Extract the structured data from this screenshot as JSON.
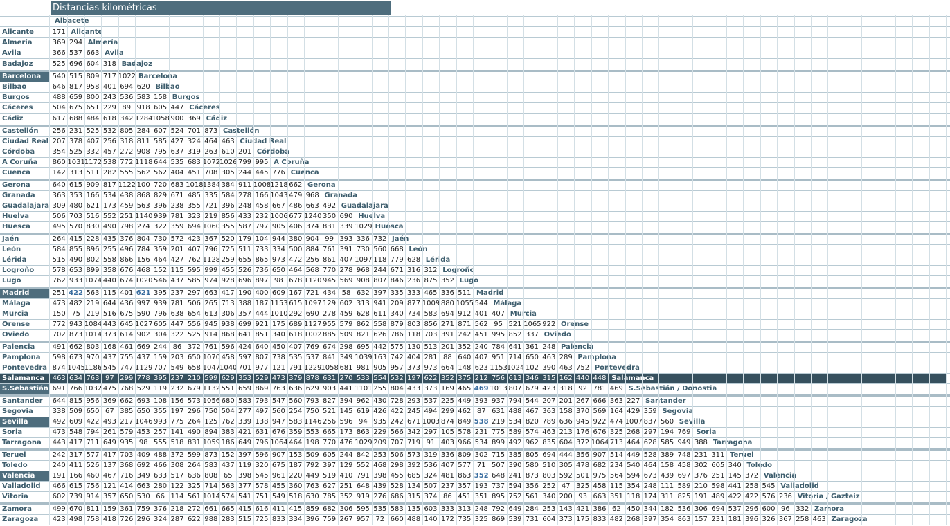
{
  "title": "Distancias kilométricas",
  "first_city": "Albacete",
  "rows": [
    {
      "name": "Alicante",
      "values": [
        "171"
      ]
    },
    {
      "name": "Almería",
      "values": [
        "369",
        "294"
      ]
    },
    {
      "name": "Avila",
      "values": [
        "366",
        "537",
        "663"
      ]
    },
    {
      "name": "Badajoz",
      "values": [
        "525",
        "696",
        "604",
        "318"
      ]
    },
    {
      "name": "Barcelona",
      "values": [
        "540",
        "515",
        "809",
        "717",
        "1022"
      ],
      "hl": true
    },
    {
      "name": "Bilbao",
      "values": [
        "646",
        "817",
        "958",
        "401",
        "694",
        "620"
      ]
    },
    {
      "name": "Burgos",
      "values": [
        "488",
        "659",
        "800",
        "243",
        "536",
        "583",
        "158"
      ]
    },
    {
      "name": "Cáceres",
      "values": [
        "504",
        "675",
        "651",
        "229",
        "89",
        "918",
        "605",
        "447"
      ]
    },
    {
      "name": "Cádiz",
      "values": [
        "617",
        "688",
        "484",
        "618",
        "342",
        "1284",
        "1058",
        "900",
        "369"
      ]
    },
    {
      "name": "Castellón",
      "values": [
        "256",
        "231",
        "525",
        "532",
        "805",
        "284",
        "607",
        "524",
        "701",
        "873"
      ]
    },
    {
      "name": "Ciudad Real",
      "values": [
        "207",
        "378",
        "407",
        "256",
        "318",
        "811",
        "585",
        "427",
        "324",
        "464",
        "463"
      ]
    },
    {
      "name": "Córdoba",
      "values": [
        "354",
        "525",
        "332",
        "457",
        "272",
        "908",
        "795",
        "637",
        "319",
        "263",
        "610",
        "201"
      ]
    },
    {
      "name": "A Coruña",
      "values": [
        "860",
        "1031",
        "1172",
        "538",
        "772",
        "1118",
        "644",
        "535",
        "683",
        "1072",
        "1026",
        "799",
        "995"
      ]
    },
    {
      "name": "Cuenca",
      "values": [
        "142",
        "313",
        "511",
        "282",
        "555",
        "562",
        "562",
        "404",
        "451",
        "708",
        "305",
        "244",
        "445",
        "776"
      ]
    },
    {
      "name": "Gerona",
      "values": [
        "640",
        "615",
        "909",
        "817",
        "1122",
        "100",
        "720",
        "683",
        "1018",
        "1384",
        "384",
        "911",
        "1008",
        "1218",
        "662"
      ]
    },
    {
      "name": "Granada",
      "values": [
        "363",
        "353",
        "166",
        "534",
        "438",
        "868",
        "829",
        "671",
        "485",
        "335",
        "584",
        "278",
        "166",
        "1043",
        "479",
        "968"
      ]
    },
    {
      "name": "Guadalajara",
      "values": [
        "309",
        "480",
        "621",
        "173",
        "459",
        "563",
        "396",
        "238",
        "355",
        "721",
        "396",
        "248",
        "458",
        "667",
        "486",
        "663",
        "492"
      ]
    },
    {
      "name": "Huelva",
      "values": [
        "506",
        "703",
        "516",
        "552",
        "251",
        "1140",
        "939",
        "781",
        "323",
        "219",
        "856",
        "433",
        "232",
        "1006",
        "677",
        "1240",
        "350",
        "690"
      ]
    },
    {
      "name": "Huesca",
      "values": [
        "495",
        "570",
        "830",
        "490",
        "798",
        "274",
        "322",
        "359",
        "694",
        "1060",
        "355",
        "587",
        "797",
        "905",
        "406",
        "374",
        "831",
        "339",
        "1029"
      ]
    },
    {
      "name": "Jaén",
      "values": [
        "264",
        "415",
        "228",
        "435",
        "376",
        "804",
        "730",
        "572",
        "423",
        "367",
        "520",
        "179",
        "104",
        "944",
        "380",
        "904",
        "99",
        "393",
        "336",
        "732"
      ]
    },
    {
      "name": "León",
      "values": [
        "584",
        "855",
        "896",
        "255",
        "496",
        "784",
        "359",
        "201",
        "407",
        "796",
        "725",
        "511",
        "733",
        "334",
        "500",
        "884",
        "761",
        "391",
        "730",
        "560",
        "668"
      ]
    },
    {
      "name": "Lérida",
      "values": [
        "515",
        "490",
        "802",
        "558",
        "866",
        "156",
        "464",
        "427",
        "762",
        "1128",
        "259",
        "655",
        "865",
        "973",
        "472",
        "256",
        "861",
        "407",
        "1097",
        "118",
        "779",
        "628"
      ]
    },
    {
      "name": "Logroño",
      "values": [
        "578",
        "653",
        "899",
        "358",
        "676",
        "468",
        "152",
        "115",
        "595",
        "999",
        "455",
        "526",
        "736",
        "650",
        "464",
        "568",
        "770",
        "278",
        "968",
        "244",
        "671",
        "316",
        "312"
      ]
    },
    {
      "name": "Lugo",
      "values": [
        "762",
        "933",
        "1074",
        "440",
        "674",
        "1020",
        "546",
        "437",
        "585",
        "974",
        "928",
        "696",
        "897",
        "98",
        "678",
        "1120",
        "945",
        "569",
        "908",
        "807",
        "846",
        "236",
        "875",
        "352"
      ]
    },
    {
      "name": "Madrid",
      "values": [
        "251",
        "422",
        "563",
        "115",
        "401",
        "621",
        "395",
        "237",
        "297",
        "663",
        "417",
        "190",
        "400",
        "609",
        "167",
        "721",
        "434",
        "58",
        "632",
        "397",
        "335",
        "333",
        "465",
        "336",
        "511"
      ],
      "hl": true,
      "blue": [
        1,
        5
      ]
    },
    {
      "name": "Málaga",
      "values": [
        "473",
        "482",
        "219",
        "644",
        "436",
        "997",
        "939",
        "781",
        "506",
        "265",
        "713",
        "388",
        "187",
        "1153",
        "615",
        "1097",
        "129",
        "602",
        "313",
        "941",
        "209",
        "877",
        "1009",
        "880",
        "1055",
        "544"
      ]
    },
    {
      "name": "Murcia",
      "values": [
        "150",
        "75",
        "219",
        "516",
        "675",
        "590",
        "796",
        "638",
        "654",
        "613",
        "306",
        "357",
        "444",
        "1010",
        "292",
        "690",
        "278",
        "459",
        "628",
        "611",
        "340",
        "734",
        "583",
        "694",
        "912",
        "401",
        "407"
      ]
    },
    {
      "name": "Orense",
      "values": [
        "772",
        "943",
        "1084",
        "443",
        "645",
        "1027",
        "605",
        "447",
        "556",
        "945",
        "938",
        "699",
        "921",
        "175",
        "689",
        "1127",
        "955",
        "579",
        "862",
        "558",
        "879",
        "803",
        "856",
        "271",
        "871",
        "562",
        "95",
        "521",
        "1065",
        "922"
      ]
    },
    {
      "name": "Oviedo",
      "values": [
        "702",
        "873",
        "1014",
        "373",
        "614",
        "902",
        "304",
        "322",
        "525",
        "914",
        "868",
        "641",
        "851",
        "340",
        "618",
        "1002",
        "885",
        "509",
        "821",
        "626",
        "786",
        "118",
        "703",
        "391",
        "242",
        "451",
        "995",
        "852",
        "337"
      ]
    },
    {
      "name": "Palencia",
      "values": [
        "491",
        "662",
        "803",
        "168",
        "461",
        "669",
        "244",
        "86",
        "372",
        "761",
        "596",
        "424",
        "640",
        "450",
        "407",
        "769",
        "674",
        "298",
        "695",
        "442",
        "575",
        "130",
        "513",
        "201",
        "352",
        "240",
        "784",
        "641",
        "361",
        "248"
      ]
    },
    {
      "name": "Pamplona",
      "values": [
        "598",
        "673",
        "970",
        "437",
        "755",
        "437",
        "159",
        "203",
        "650",
        "1070",
        "458",
        "597",
        "807",
        "738",
        "535",
        "537",
        "841",
        "349",
        "1039",
        "163",
        "742",
        "404",
        "281",
        "88",
        "640",
        "407",
        "951",
        "714",
        "650",
        "463",
        "289"
      ]
    },
    {
      "name": "Pontevedra",
      "values": [
        "874",
        "1045",
        "1186",
        "545",
        "747",
        "1129",
        "707",
        "549",
        "658",
        "1047",
        "1040",
        "701",
        "977",
        "121",
        "791",
        "1229",
        "1058",
        "681",
        "981",
        "905",
        "957",
        "373",
        "973",
        "664",
        "148",
        "623",
        "1153",
        "1024",
        "102",
        "390",
        "463",
        "752"
      ]
    },
    {
      "name": "Salamanca",
      "values": [
        "463",
        "634",
        "763",
        "97",
        "299",
        "778",
        "395",
        "237",
        "210",
        "599",
        "629",
        "353",
        "529",
        "473",
        "379",
        "878",
        "631",
        "270",
        "533",
        "554",
        "532",
        "197",
        "622",
        "352",
        "375",
        "212",
        "756",
        "613",
        "346",
        "315",
        "162",
        "440",
        "448"
      ],
      "dark": true
    },
    {
      "name": "S.Sebastián",
      "values": [
        "691",
        "766",
        "1032",
        "475",
        "768",
        "529",
        "119",
        "232",
        "679",
        "1132",
        "551",
        "659",
        "869",
        "763",
        "636",
        "629",
        "903",
        "441",
        "1101",
        "255",
        "804",
        "433",
        "373",
        "169",
        "465",
        "469",
        "1013",
        "807",
        "679",
        "423",
        "318",
        "92",
        "781",
        "469"
      ],
      "hl": true,
      "blue": [
        25
      ],
      "label": "S.Sebastián / Donostia"
    },
    {
      "name": "Santander",
      "values": [
        "644",
        "815",
        "956",
        "369",
        "662",
        "693",
        "108",
        "156",
        "573",
        "1056",
        "680",
        "583",
        "793",
        "547",
        "560",
        "793",
        "827",
        "394",
        "962",
        "430",
        "728",
        "293",
        "537",
        "225",
        "449",
        "393",
        "937",
        "794",
        "544",
        "207",
        "201",
        "267",
        "666",
        "363",
        "227"
      ]
    },
    {
      "name": "Segovia",
      "values": [
        "338",
        "509",
        "650",
        "67",
        "385",
        "650",
        "355",
        "197",
        "296",
        "750",
        "504",
        "277",
        "497",
        "560",
        "254",
        "750",
        "521",
        "145",
        "619",
        "426",
        "422",
        "245",
        "494",
        "299",
        "462",
        "87",
        "631",
        "488",
        "467",
        "363",
        "158",
        "370",
        "569",
        "164",
        "429",
        "359"
      ]
    },
    {
      "name": "Sevilla",
      "values": [
        "492",
        "609",
        "422",
        "493",
        "217",
        "1046",
        "993",
        "775",
        "264",
        "125",
        "762",
        "339",
        "138",
        "947",
        "583",
        "1146",
        "256",
        "596",
        "94",
        "935",
        "242",
        "671",
        "1003",
        "874",
        "849",
        "538",
        "219",
        "534",
        "820",
        "789",
        "636",
        "945",
        "922",
        "474",
        "1007",
        "837",
        "560"
      ],
      "hl": true,
      "blue": [
        25
      ]
    },
    {
      "name": "Soria",
      "values": [
        "473",
        "548",
        "794",
        "261",
        "579",
        "453",
        "257",
        "141",
        "490",
        "894",
        "383",
        "421",
        "631",
        "676",
        "359",
        "553",
        "665",
        "173",
        "863",
        "229",
        "566",
        "342",
        "297",
        "105",
        "578",
        "231",
        "775",
        "589",
        "574",
        "463",
        "213",
        "176",
        "676",
        "325",
        "268",
        "297",
        "194",
        "769"
      ]
    },
    {
      "name": "Tarragona",
      "values": [
        "443",
        "417",
        "711",
        "649",
        "935",
        "98",
        "555",
        "518",
        "831",
        "1059",
        "186",
        "649",
        "796",
        "1064",
        "464",
        "198",
        "770",
        "476",
        "1029",
        "209",
        "707",
        "719",
        "91",
        "403",
        "966",
        "534",
        "899",
        "492",
        "962",
        "835",
        "604",
        "372",
        "1064",
        "713",
        "464",
        "628",
        "585",
        "949",
        "388"
      ]
    },
    {
      "name": "Teruel",
      "values": [
        "242",
        "317",
        "577",
        "417",
        "703",
        "409",
        "488",
        "372",
        "599",
        "873",
        "152",
        "397",
        "596",
        "907",
        "153",
        "509",
        "605",
        "244",
        "842",
        "253",
        "506",
        "573",
        "319",
        "336",
        "809",
        "302",
        "715",
        "385",
        "805",
        "694",
        "444",
        "356",
        "907",
        "514",
        "449",
        "528",
        "389",
        "748",
        "231",
        "311"
      ]
    },
    {
      "name": "Toledo",
      "values": [
        "240",
        "411",
        "526",
        "137",
        "368",
        "692",
        "466",
        "308",
        "264",
        "583",
        "437",
        "119",
        "320",
        "675",
        "187",
        "792",
        "397",
        "129",
        "552",
        "468",
        "298",
        "392",
        "536",
        "407",
        "577",
        "71",
        "507",
        "390",
        "580",
        "510",
        "305",
        "478",
        "682",
        "234",
        "540",
        "464",
        "158",
        "458",
        "302",
        "605",
        "340"
      ]
    },
    {
      "name": "Valencia",
      "values": [
        "191",
        "166",
        "460",
        "467",
        "716",
        "349",
        "633",
        "517",
        "636",
        "808",
        "65",
        "398",
        "545",
        "961",
        "220",
        "449",
        "519",
        "410",
        "791",
        "398",
        "455",
        "685",
        "324",
        "481",
        "863",
        "352",
        "648",
        "241",
        "873",
        "803",
        "592",
        "501",
        "975",
        "564",
        "594",
        "673",
        "439",
        "697",
        "376",
        "251",
        "145",
        "372"
      ],
      "hl": true,
      "blue": [
        25
      ]
    },
    {
      "name": "Valladolid",
      "values": [
        "466",
        "615",
        "756",
        "121",
        "414",
        "663",
        "280",
        "122",
        "325",
        "714",
        "563",
        "377",
        "578",
        "455",
        "360",
        "763",
        "627",
        "251",
        "648",
        "439",
        "528",
        "134",
        "507",
        "237",
        "357",
        "193",
        "737",
        "594",
        "356",
        "252",
        "47",
        "325",
        "458",
        "115",
        "354",
        "248",
        "111",
        "589",
        "210",
        "598",
        "441",
        "258",
        "545"
      ]
    },
    {
      "name": "Vitoria",
      "values": [
        "602",
        "739",
        "914",
        "357",
        "650",
        "530",
        "66",
        "114",
        "561",
        "1014",
        "574",
        "541",
        "751",
        "549",
        "518",
        "630",
        "785",
        "352",
        "919",
        "276",
        "686",
        "315",
        "374",
        "86",
        "451",
        "351",
        "895",
        "752",
        "561",
        "340",
        "200",
        "93",
        "663",
        "351",
        "118",
        "174",
        "311",
        "825",
        "191",
        "489",
        "422",
        "422",
        "576",
        "236"
      ],
      "label": "Vitoria / Gazteiz"
    },
    {
      "name": "Zamora",
      "values": [
        "499",
        "670",
        "811",
        "159",
        "361",
        "759",
        "376",
        "218",
        "272",
        "661",
        "665",
        "415",
        "616",
        "411",
        "415",
        "859",
        "682",
        "306",
        "595",
        "535",
        "583",
        "135",
        "603",
        "333",
        "313",
        "248",
        "792",
        "649",
        "284",
        "253",
        "143",
        "421",
        "386",
        "62",
        "450",
        "344",
        "182",
        "536",
        "306",
        "694",
        "537",
        "296",
        "600",
        "96",
        "332"
      ]
    },
    {
      "name": "Zaragoza",
      "values": [
        "423",
        "498",
        "758",
        "418",
        "726",
        "296",
        "324",
        "287",
        "622",
        "988",
        "283",
        "515",
        "725",
        "833",
        "334",
        "396",
        "759",
        "267",
        "957",
        "72",
        "660",
        "488",
        "140",
        "172",
        "735",
        "325",
        "869",
        "539",
        "731",
        "604",
        "373",
        "175",
        "833",
        "482",
        "268",
        "397",
        "354",
        "863",
        "157",
        "231",
        "181",
        "396",
        "326",
        "367",
        "258",
        "463"
      ]
    }
  ]
}
